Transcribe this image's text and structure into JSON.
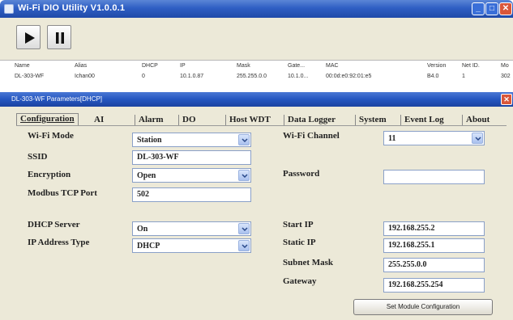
{
  "window": {
    "title": "Wi-Fi DIO Utility V1.0.0.1"
  },
  "toolbar": {
    "play_icon": "play-icon",
    "pause_icon": "pause-icon"
  },
  "device_list": {
    "columns": [
      "Name",
      "Alias",
      "DHCP",
      "IP",
      "Mask",
      "Gateway",
      "MAC",
      "Version",
      "Net ID",
      "Model"
    ],
    "columns_display": [
      "Name",
      "Alias",
      "DHCP",
      "IP",
      "Mask",
      "Gate...",
      "MAC",
      "Version",
      "Net ID.",
      "Mo"
    ],
    "rows": [
      {
        "name": "DL-303-WF",
        "alias": "Ichan00",
        "dhcp": "0",
        "ip": "10.1.0.87",
        "mask": "255.255.0.0",
        "gateway": "10.1.0...",
        "mac": "00:0d:e0:92:01:e5",
        "version": "B4.0",
        "net_id": "1",
        "model": "302"
      }
    ]
  },
  "dialog": {
    "title": "DL-303-WF Parameters[DHCP]",
    "tabs": [
      "Configuration",
      "AI",
      "Alarm",
      "DO",
      "Host WDT",
      "Data Logger",
      "System",
      "Event Log",
      "About"
    ],
    "active_tab": "Configuration",
    "left": {
      "wifi_mode_label": "Wi-Fi Mode",
      "wifi_mode_value": "Station",
      "ssid_label": "SSID",
      "ssid_value": "DL-303-WF",
      "encryption_label": "Encryption",
      "encryption_value": "Open",
      "modbus_port_label": "Modbus TCP Port",
      "modbus_port_value": "502",
      "dhcp_server_label": "DHCP Server",
      "dhcp_server_value": "On",
      "ip_type_label": "IP Address Type",
      "ip_type_value": "DHCP"
    },
    "right": {
      "wifi_channel_label": "Wi-Fi Channel",
      "wifi_channel_value": "11",
      "password_label": "Password",
      "password_value": "",
      "start_ip_label": "Start IP",
      "start_ip_value": "192.168.255.2",
      "static_ip_label": "Static IP",
      "static_ip_value": "192.168.255.1",
      "subnet_mask_label": "Subnet Mask",
      "subnet_mask_value": "255.255.0.0",
      "gateway_label": "Gateway",
      "gateway_value": "192.168.255.254"
    },
    "set_button_label": "Set Module Configuration"
  },
  "colors": {
    "title_bar": "#2f5fc4",
    "dialog_face": "#ece9d8",
    "close_button": "#d9573a"
  }
}
